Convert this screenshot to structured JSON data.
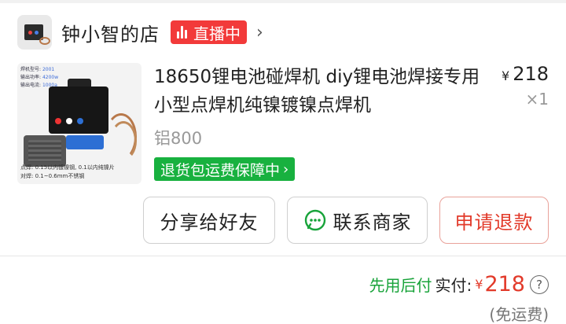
{
  "shop": {
    "name": "钟小智的店",
    "live_label": "直播中",
    "chevron": "›"
  },
  "product": {
    "image": {
      "spec_lines": [
        {
          "label": "焊机型号:",
          "value": "2001"
        },
        {
          "label": "输出功率:",
          "value": "4200w"
        },
        {
          "label": "输出电流:",
          "value": "1000a"
        }
      ],
      "bottom_lines": [
        "点焊: 0.15以内镀镍钢, 0.1以内纯镍片",
        "对焊: 0.1~0.6mm不锈钢"
      ]
    },
    "title": "18650锂电池碰焊机 diy锂电池焊接专用 小型点焊机纯镍镀镍点焊机",
    "price_symbol": "¥",
    "price": "218",
    "quantity": "×1",
    "sku": "铝800",
    "guarantee": "退货包运费保障中",
    "guarantee_chevron": "›"
  },
  "actions": {
    "share": "分享给好友",
    "contact": "联系商家",
    "refund": "申请退款"
  },
  "totals": {
    "pay_later": "先用后付",
    "paid_label": "实付:",
    "currency": "¥",
    "amount": "218",
    "help": "?",
    "shipping_note": "(免运费)"
  },
  "colors": {
    "live_badge": "#f23a3a",
    "guarantee": "#18b13f",
    "refund": "#e23a2a",
    "pay_later": "#18a33a"
  }
}
